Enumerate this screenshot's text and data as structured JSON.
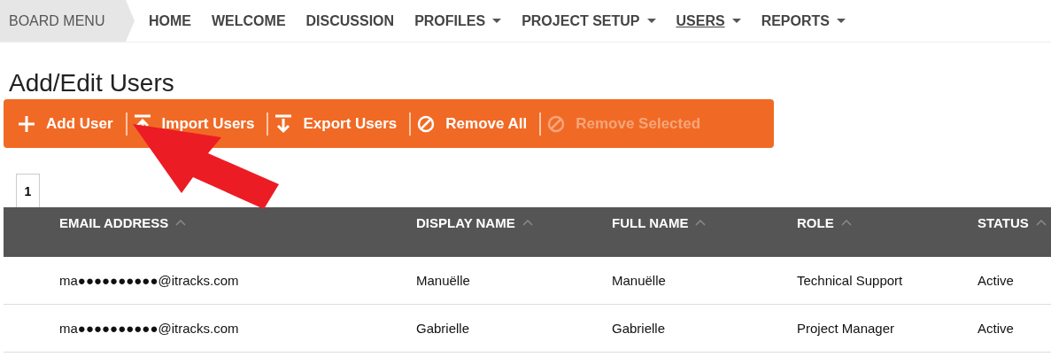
{
  "board_menu": {
    "label": "BOARD MENU"
  },
  "nav": [
    {
      "label": "HOME",
      "dropdown": false,
      "selected": false
    },
    {
      "label": "WELCOME",
      "dropdown": false,
      "selected": false
    },
    {
      "label": "DISCUSSION",
      "dropdown": false,
      "selected": false
    },
    {
      "label": "PROFILES",
      "dropdown": true,
      "selected": false
    },
    {
      "label": "PROJECT SETUP",
      "dropdown": true,
      "selected": false
    },
    {
      "label": "USERS",
      "dropdown": true,
      "selected": true
    },
    {
      "label": "REPORTS",
      "dropdown": true,
      "selected": false
    }
  ],
  "page_title": "Add/Edit Users",
  "toolbar": [
    {
      "label": "Add User",
      "kind": "add",
      "disabled": false
    },
    {
      "label": "Import Users",
      "kind": "import",
      "disabled": false
    },
    {
      "label": "Export Users",
      "kind": "export",
      "disabled": false
    },
    {
      "label": "Remove All",
      "kind": "remove",
      "disabled": false
    },
    {
      "label": "Remove Selected",
      "kind": "remove",
      "disabled": true
    }
  ],
  "pagination": [
    {
      "label": "1",
      "selected": true
    }
  ],
  "table": {
    "columns": [
      "EMAIL ADDRESS",
      "DISPLAY NAME",
      "FULL NAME",
      "ROLE",
      "STATUS"
    ],
    "rows": [
      [
        "ma●●●●●●●●●●@itracks.com",
        "Manuëlle",
        "Manuëlle",
        "Technical Support",
        "Active"
      ],
      [
        "ma●●●●●●●●●●@itracks.com",
        "Gabrielle",
        "Gabrielle",
        "Project Manager",
        "Active"
      ]
    ]
  }
}
